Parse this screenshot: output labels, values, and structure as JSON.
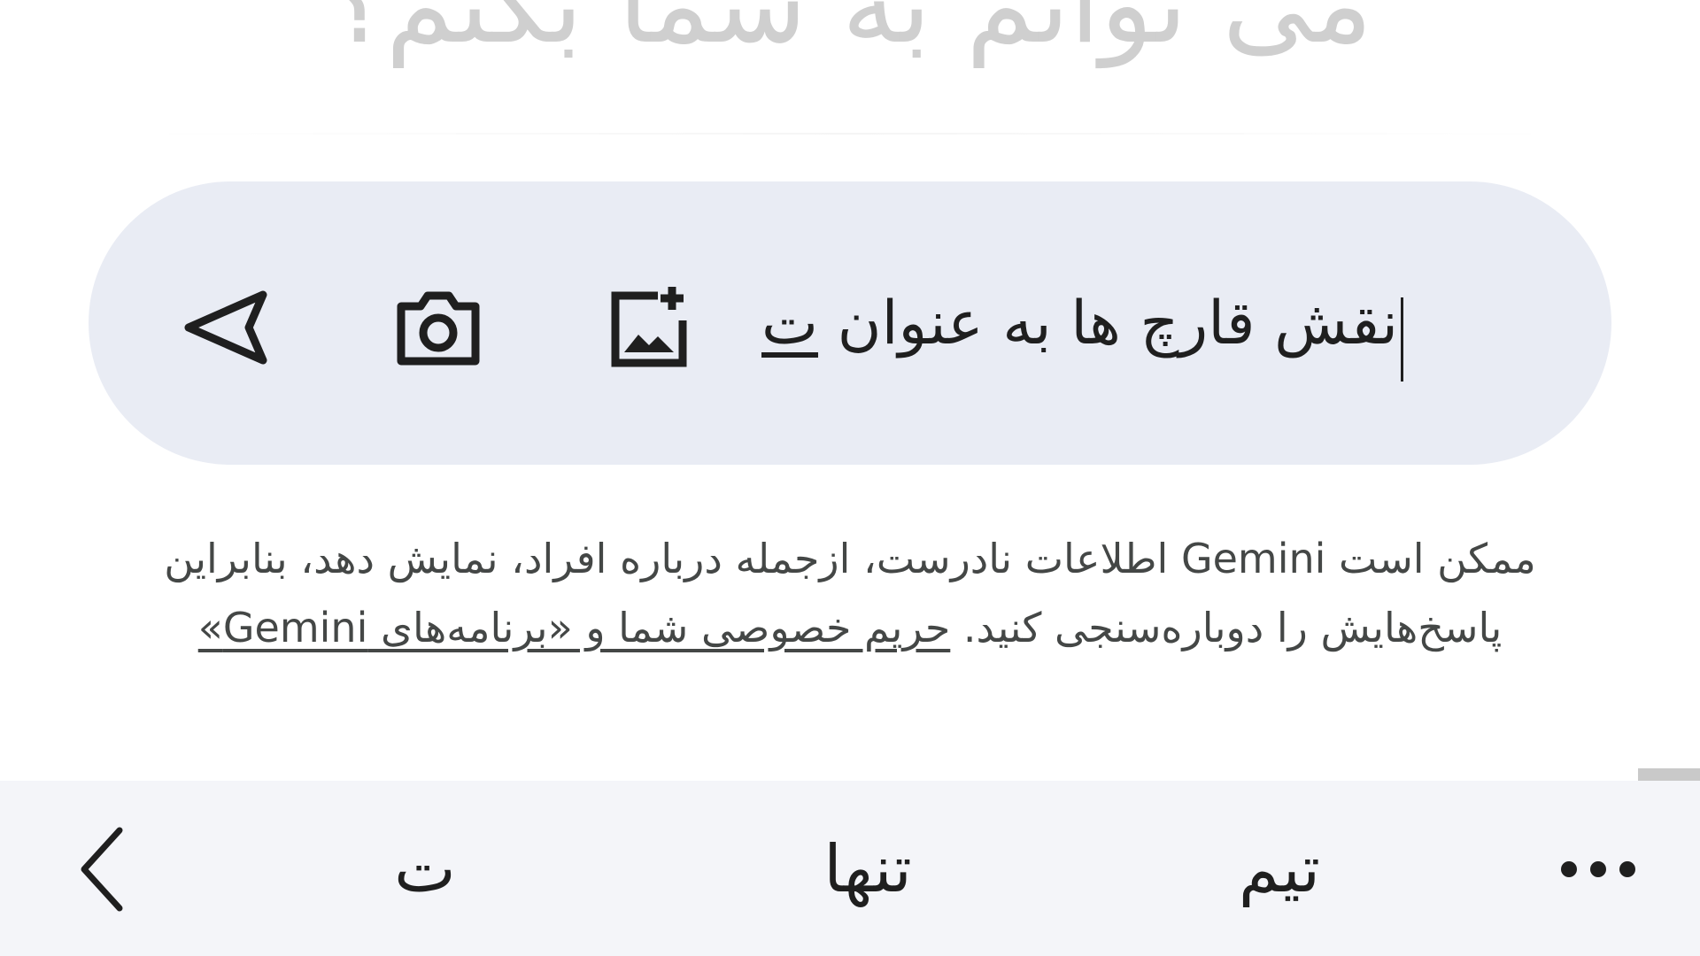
{
  "header": {
    "headline": "می توانم به شما بکنم؟"
  },
  "input": {
    "text_main": "نقش قارچ ها به عنوان ",
    "text_composing": "ت",
    "icons": [
      "send-icon",
      "camera-icon",
      "add-image-icon"
    ]
  },
  "disclaimer": {
    "text": "ممکن است Gemini اطلاعات نادرست، ازجمله درباره افراد، نمایش دهد، بنابراین پاسخ‌هایش را دوباره‌سنجی کنید. ",
    "link": "حریم خصوصی شما و «برنامه‌های Gemini»"
  },
  "keyboard_suggestions": {
    "items": [
      "تیم",
      "تنها",
      "ت"
    ],
    "icons": [
      "chevron-left-icon",
      "more-icon"
    ]
  }
}
